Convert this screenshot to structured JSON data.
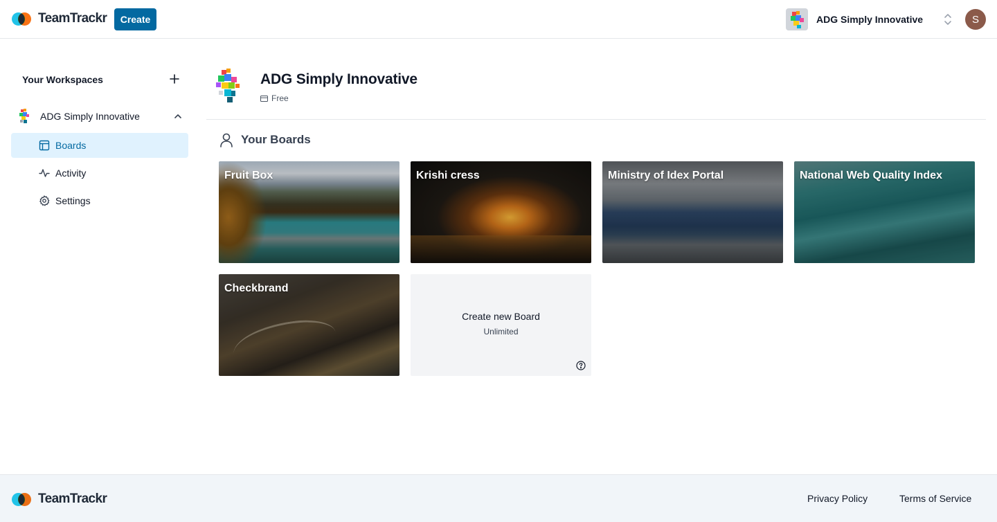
{
  "header": {
    "brand": "TeamTrackr",
    "create_label": "Create",
    "workspace_name": "ADG Simply Innovative",
    "avatar_initial": "S"
  },
  "sidebar": {
    "title": "Your Workspaces",
    "workspace_name": "ADG Simply Innovative",
    "items": [
      {
        "label": "Boards",
        "icon": "board-icon",
        "active": true
      },
      {
        "label": "Activity",
        "icon": "activity-icon",
        "active": false
      },
      {
        "label": "Settings",
        "icon": "gear-icon",
        "active": false
      }
    ]
  },
  "main": {
    "org_title": "ADG Simply Innovative",
    "plan": "Free",
    "boards_heading": "Your Boards",
    "boards": [
      {
        "title": "Fruit Box"
      },
      {
        "title": "Krishi cress"
      },
      {
        "title": "Ministry of Idex Portal"
      },
      {
        "title": "National Web Quality Index"
      },
      {
        "title": "Checkbrand"
      }
    ],
    "new_board": {
      "label": "Create new Board",
      "sub": "Unlimited"
    }
  },
  "footer": {
    "brand": "TeamTrackr",
    "privacy": "Privacy Policy",
    "terms": "Terms of Service"
  },
  "colors": {
    "primary": "#0369a1",
    "active_bg": "#e0f2fe",
    "footer_bg": "#f1f5f9"
  }
}
